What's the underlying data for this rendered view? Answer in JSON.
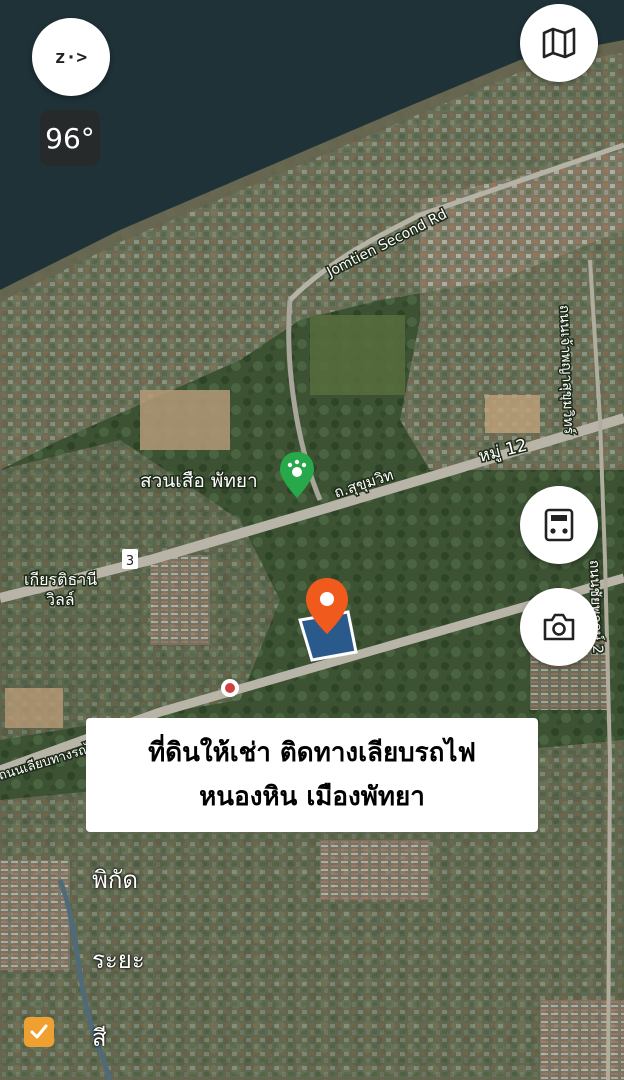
{
  "map": {
    "road_jomtien": "Jomtien Second Rd",
    "road_sukhumvit": "ถ.สุขุมวิท",
    "moo_label": "หมู่ 12",
    "zoo_label": "สวนเสือ พัทยา",
    "village_line1": "เกียรติธานี",
    "village_line2": "วิลล์",
    "route_number": "3",
    "road_vertical_1": "ถนนเจ้าพญาสุขุมวิทร์",
    "road_vertical_2": "ถนนชัยพฤกษ์ 2",
    "road_rail": "ถนนเลียบทางรถไฟ"
  },
  "controls": {
    "compass_glyph": "z·>",
    "heading_value": "96°"
  },
  "banner": {
    "line1": "ที่ดินให้เช่า ติดทางเลียบรถไฟ",
    "line2": "หนองหิน เมืองพัทยา"
  },
  "side": {
    "label1": "พิกัด",
    "label2": "ระยะ",
    "label3": "สี"
  },
  "colors": {
    "sea": "#1f3238",
    "parcel": "#2a5a8c",
    "pin": "#f05a1c",
    "zoo_marker": "#27a84a",
    "check": "#f0a030"
  },
  "icons": [
    "map-icon",
    "calculator-icon",
    "camera-icon",
    "location-pin-icon",
    "paw-icon",
    "check-icon"
  ]
}
